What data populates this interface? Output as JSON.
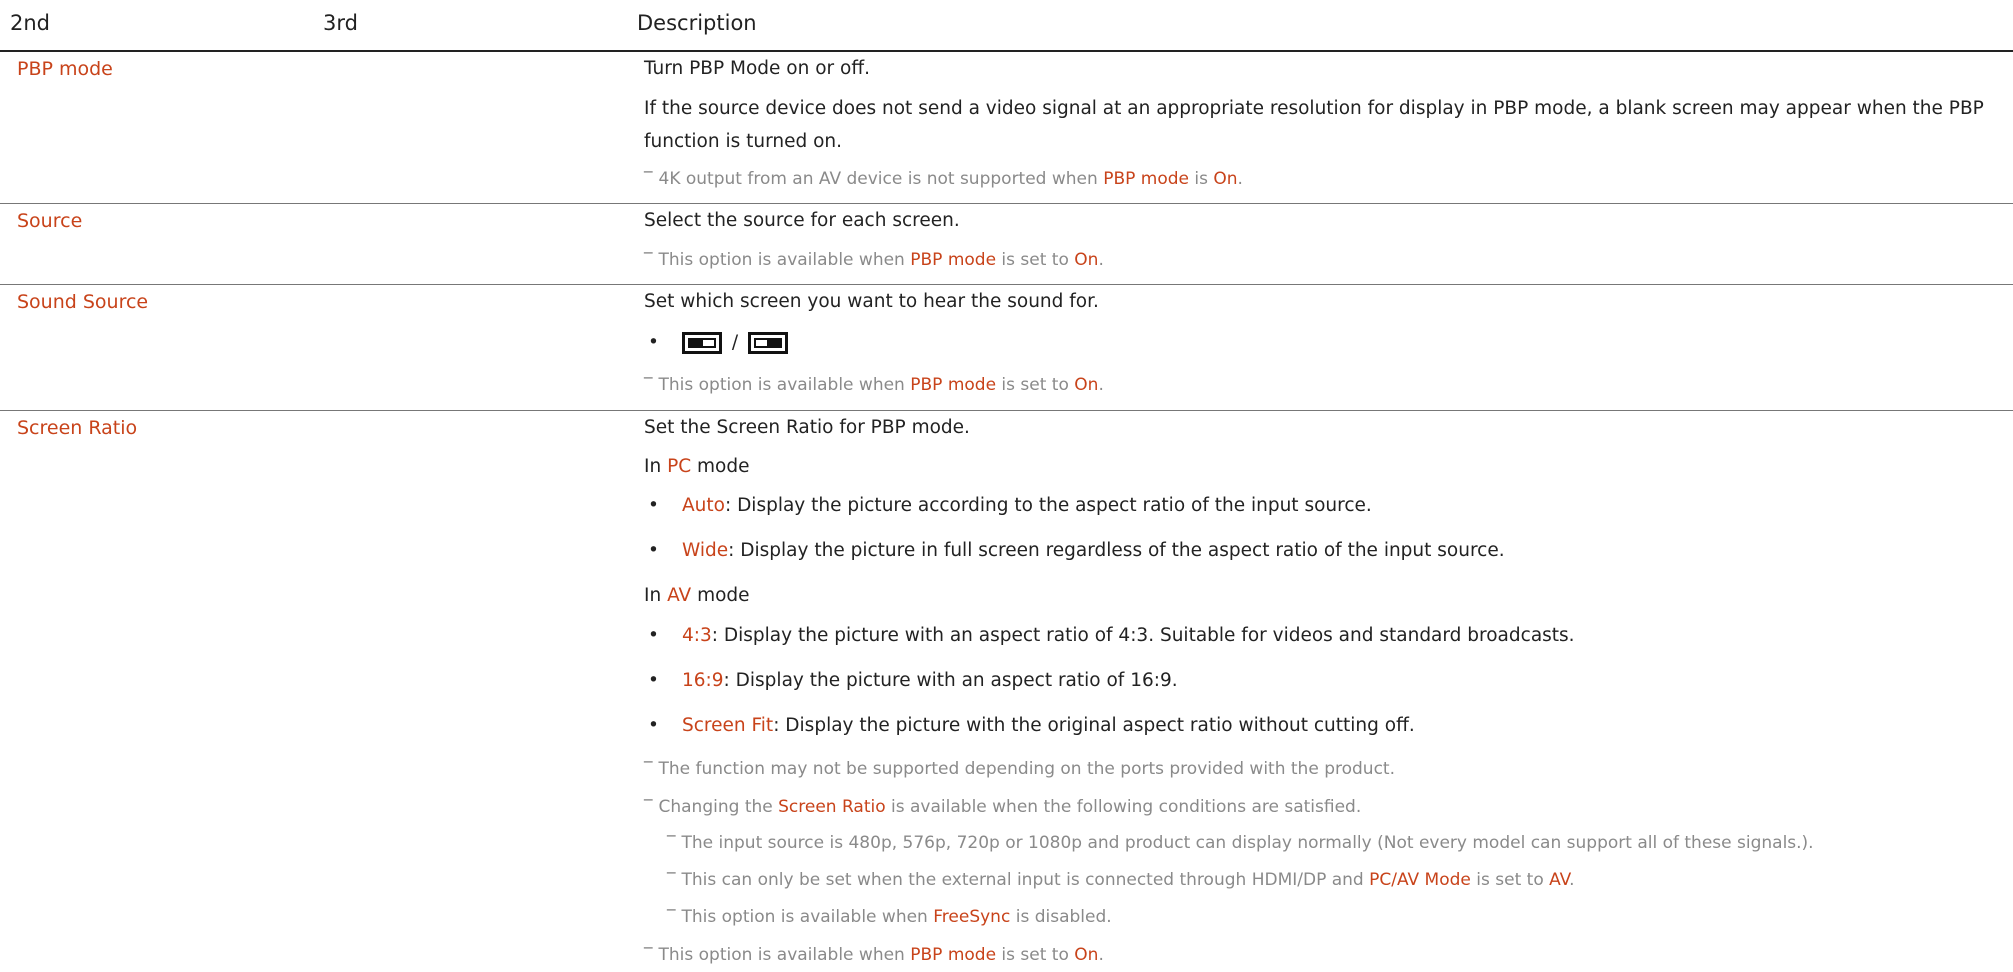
{
  "header": {
    "col_2nd": "2nd",
    "col_3rd": "3rd",
    "col_desc": "Description"
  },
  "rows": {
    "pbp": {
      "label": "PBP mode",
      "desc1": "Turn PBP Mode on or off.",
      "desc2a": "If the source device does not send a video signal at an appropriate resolution for display in PBP mode, a blank screen may appear when the PBP",
      "desc2b": "function is turned on.",
      "note_pre": "4K output from an AV device is not supported when ",
      "note_hl1": "PBP mode",
      "note_mid": " is ",
      "note_hl2": "On",
      "note_end": "."
    },
    "source": {
      "label": "Source",
      "desc1": "Select the source for each screen.",
      "note_pre": "This option is available when ",
      "note_hl1": "PBP mode",
      "note_mid": " is set to ",
      "note_hl2": "On",
      "note_end": "."
    },
    "sound": {
      "label": "Sound Source",
      "desc1": "Set which screen you want to hear the sound for.",
      "icon_sep": "/",
      "icon_left": "screen-left-icon",
      "icon_right": "screen-right-icon",
      "note_pre": "This option is available when ",
      "note_hl1": "PBP mode",
      "note_mid": " is set to ",
      "note_hl2": "On",
      "note_end": "."
    },
    "ratio": {
      "label": "Screen Ratio",
      "desc1": "Set the Screen Ratio for PBP mode.",
      "pc_pre": "In ",
      "pc_hl": "PC",
      "pc_post": " mode",
      "pc_items": [
        {
          "term": "Auto",
          "text": ": Display the picture according to the aspect ratio of the input source."
        },
        {
          "term": "Wide",
          "text": ": Display the picture in full screen regardless of the aspect ratio of the input source."
        }
      ],
      "av_pre": "In ",
      "av_hl": "AV",
      "av_post": " mode",
      "av_items": [
        {
          "term": "4:3",
          "text": ": Display the picture with an aspect ratio of 4:3. Suitable for videos and standard broadcasts."
        },
        {
          "term": "16:9",
          "text": ": Display the picture with an aspect ratio of 16:9."
        },
        {
          "term": "Screen Fit",
          "text": ": Display the picture with the original aspect ratio without cutting off."
        }
      ],
      "note1": "The function may not be supported depending on the ports provided with the product.",
      "note2_pre": "Changing the ",
      "note2_hl": "Screen Ratio",
      "note2_post": " is available when the following conditions are satisfied.",
      "sub1": "The input source is 480p, 576p, 720p or 1080p and product can display normally (Not every model can support all of these signals.).",
      "sub2_pre": "This can only be set when the external input is connected through HDMI/DP and ",
      "sub2_hl1": "PC/AV Mode",
      "sub2_mid": " is set to ",
      "sub2_hl2": "AV",
      "sub2_end": ".",
      "sub3_pre": "This option is available when ",
      "sub3_hl": "FreeSync",
      "sub3_post": " is disabled.",
      "note3_pre": "This option is available when ",
      "note3_hl1": "PBP mode",
      "note3_mid": " is set to ",
      "note3_hl2": "On",
      "note3_end": "."
    }
  },
  "colors": {
    "accent": "#c8431a",
    "note_gray": "#8a8a8a",
    "text": "#222222"
  }
}
